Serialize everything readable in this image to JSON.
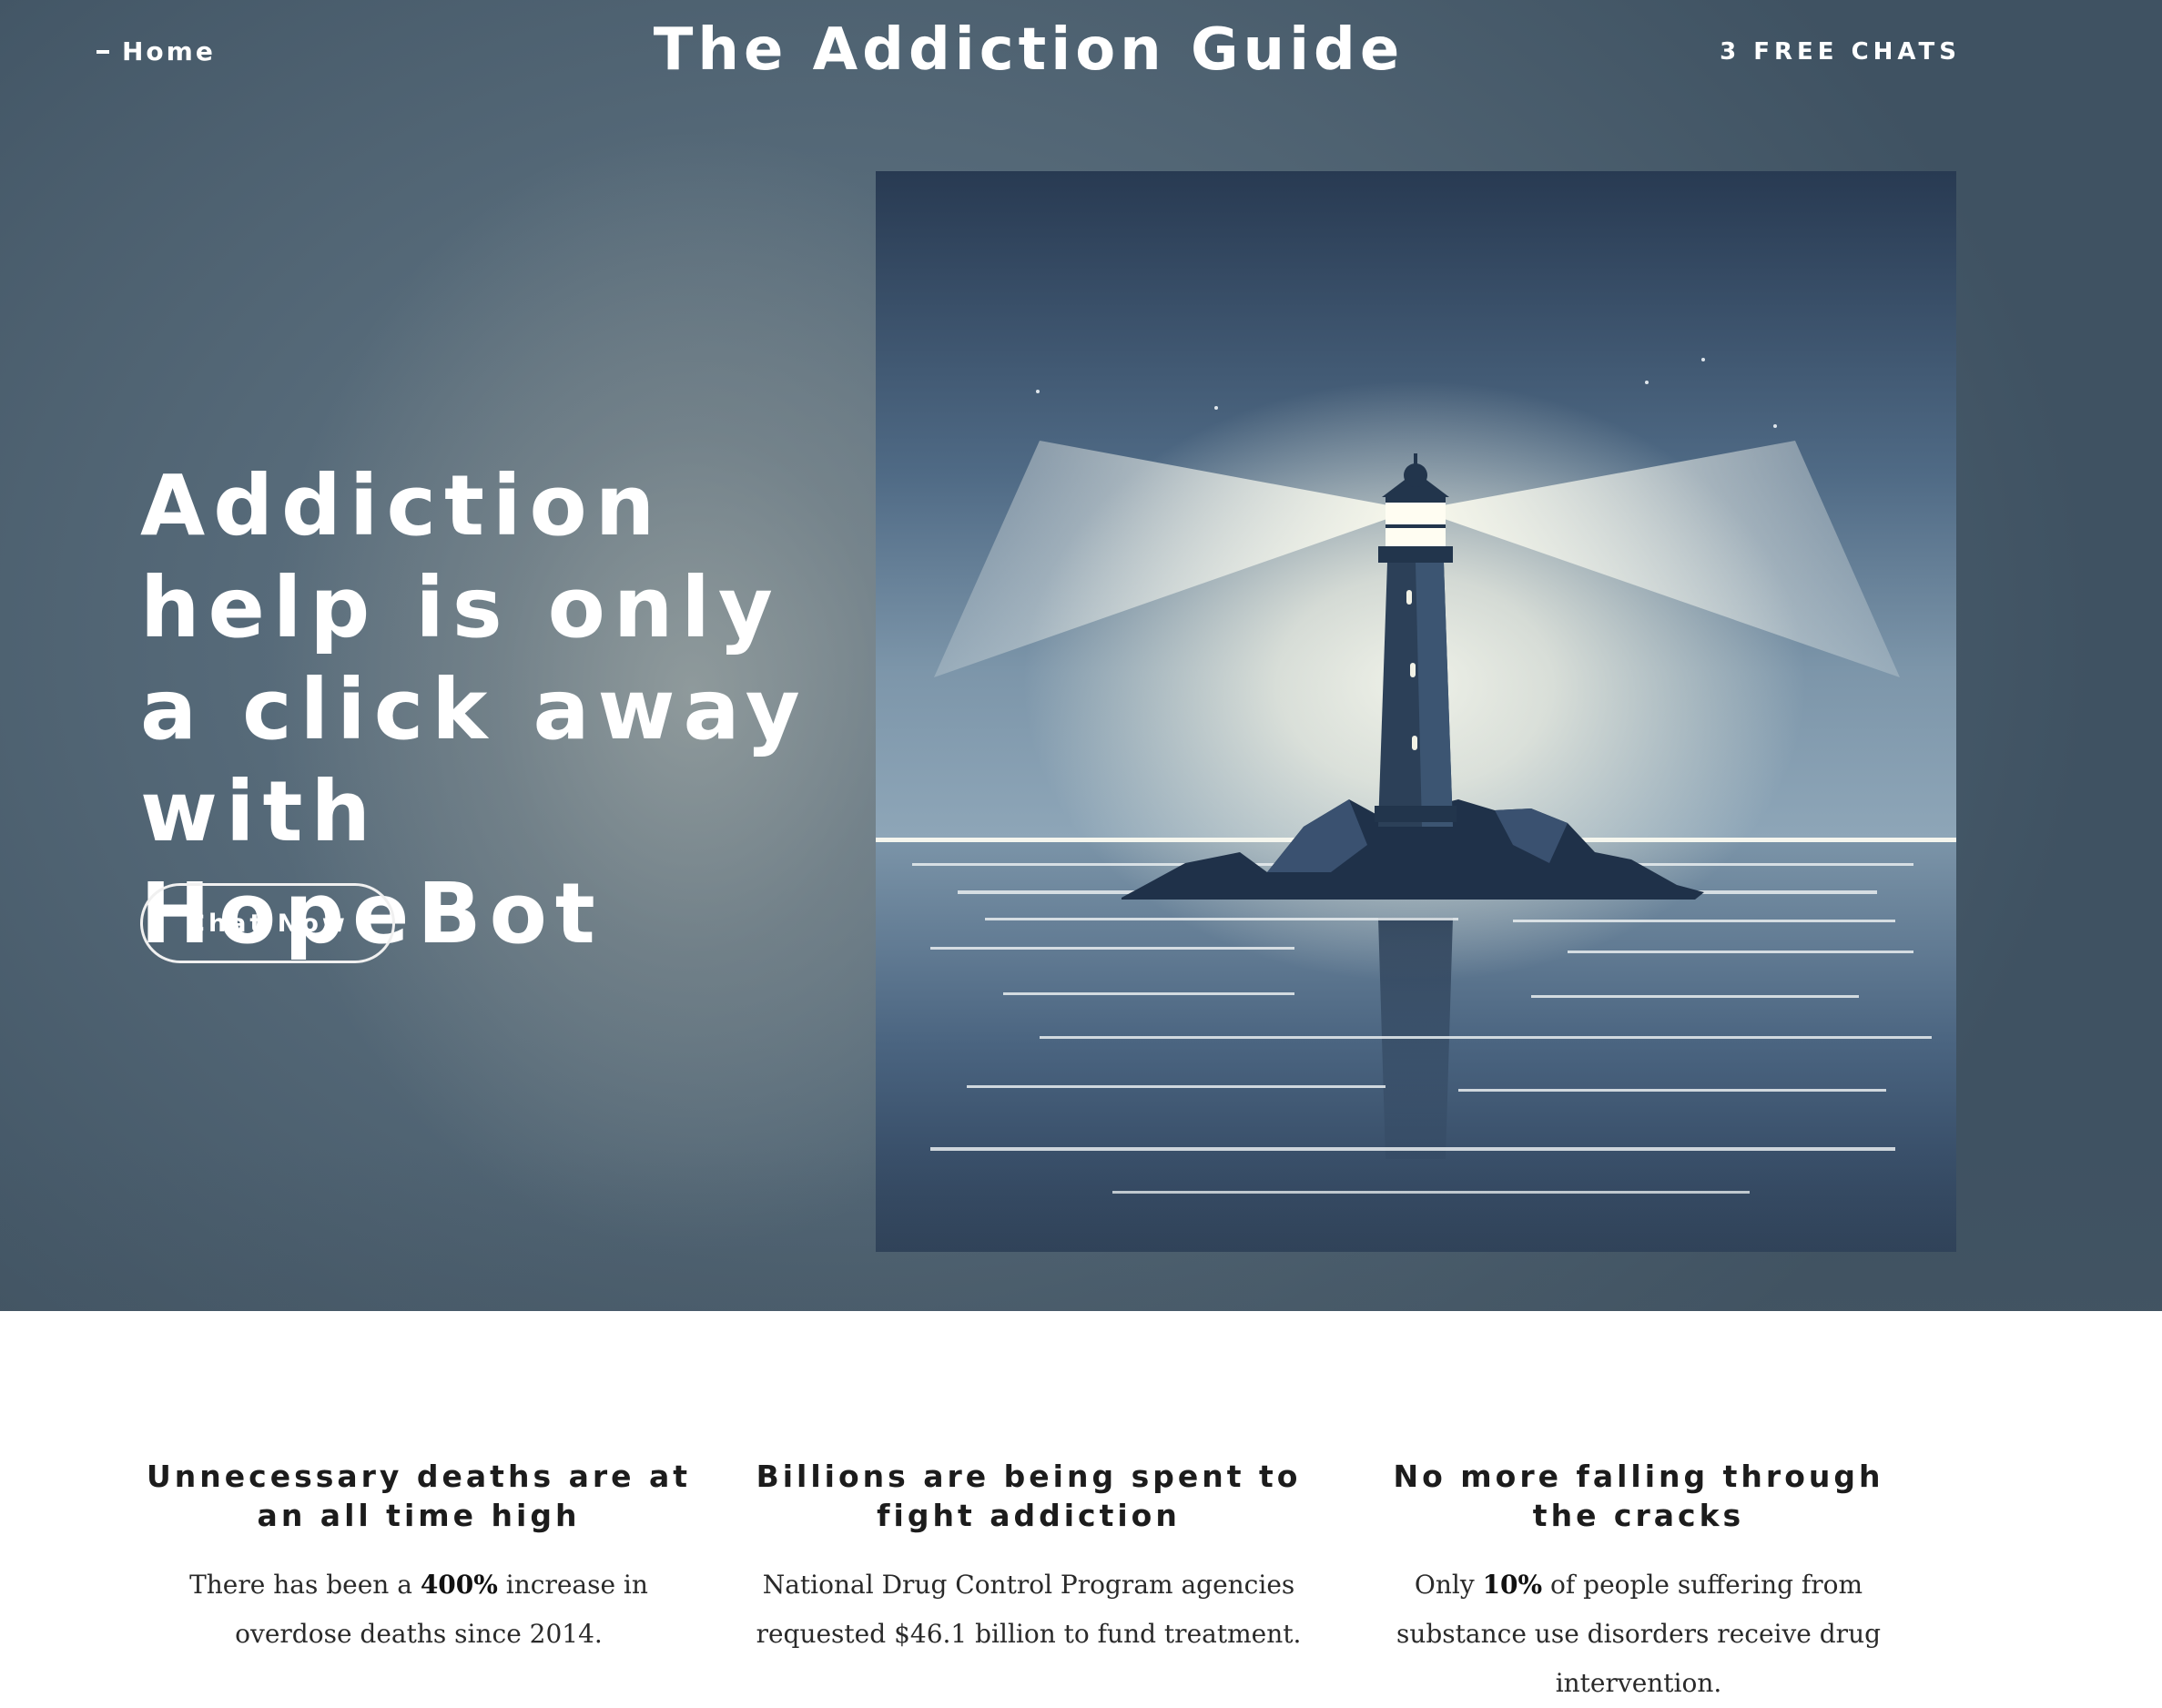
{
  "nav": {
    "home_label": "Home",
    "site_title": "The Addiction Guide",
    "chats_label": "3 FREE CHATS"
  },
  "hero": {
    "headline": "Addiction help is only a click away with HopeBot",
    "cta_label": "Chat Now",
    "illustration": "lighthouse-on-rocky-island-at-night"
  },
  "features": [
    {
      "title": "Unnecessary deaths are at an all time high",
      "text_before": "There has been a ",
      "highlight": "400%",
      "text_after": " increase in overdose deaths since 2014."
    },
    {
      "title": "Billions are being spent to fight addiction",
      "text_before": "National Drug Control Program agencies requested $46.1 billion to fund treatment.",
      "highlight": "",
      "text_after": ""
    },
    {
      "title": "No more falling through the cracks",
      "text_before": "Only ",
      "highlight": "10%",
      "text_after": " of people suffering from substance use disorders receive drug intervention."
    }
  ],
  "colors": {
    "hero_bg": "#566a79",
    "art_sky_top": "#283a52",
    "art_sky_bottom": "#7d96aa",
    "light_beam": "#f7f7ea",
    "lighthouse": "#2c4058"
  }
}
